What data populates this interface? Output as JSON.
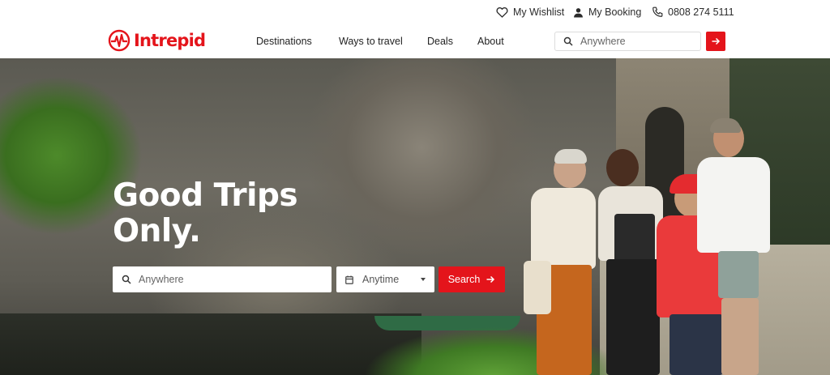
{
  "utility": {
    "wishlist_label": "My Wishlist",
    "booking_label": "My Booking",
    "phone_label": "0808 274 5111"
  },
  "brand": {
    "name": "Intrepid",
    "color": "#e4141b"
  },
  "nav": {
    "items": [
      {
        "label": "Destinations"
      },
      {
        "label": "Ways to travel"
      },
      {
        "label": "Deals"
      },
      {
        "label": "About"
      }
    ],
    "search": {
      "placeholder": "Anywhere",
      "icon": "search-icon",
      "submit_icon": "arrow-right-icon"
    }
  },
  "hero": {
    "headline_line1": "Good Trips",
    "headline_line2": "Only.",
    "where_placeholder": "Anywhere",
    "when_label": "Anytime",
    "when_icon": "calendar-icon",
    "search_label": "Search",
    "search_icon": "arrow-right-icon"
  }
}
